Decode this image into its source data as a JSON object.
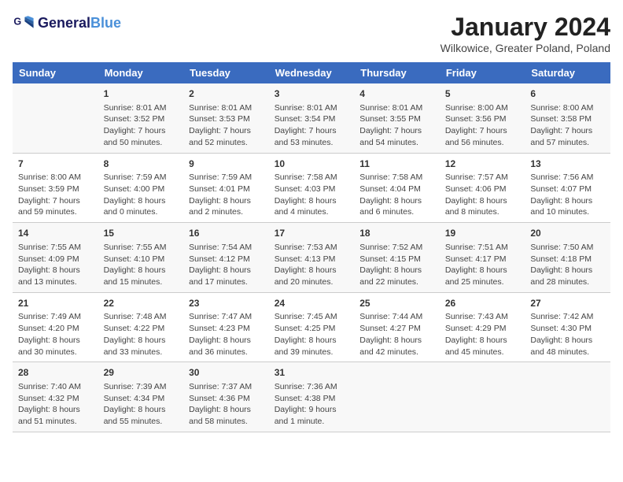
{
  "header": {
    "logo_line1": "General",
    "logo_line2": "Blue",
    "month_year": "January 2024",
    "location": "Wilkowice, Greater Poland, Poland"
  },
  "days_of_week": [
    "Sunday",
    "Monday",
    "Tuesday",
    "Wednesday",
    "Thursday",
    "Friday",
    "Saturday"
  ],
  "weeks": [
    [
      {
        "day": "",
        "info": ""
      },
      {
        "day": "1",
        "info": "Sunrise: 8:01 AM\nSunset: 3:52 PM\nDaylight: 7 hours\nand 50 minutes."
      },
      {
        "day": "2",
        "info": "Sunrise: 8:01 AM\nSunset: 3:53 PM\nDaylight: 7 hours\nand 52 minutes."
      },
      {
        "day": "3",
        "info": "Sunrise: 8:01 AM\nSunset: 3:54 PM\nDaylight: 7 hours\nand 53 minutes."
      },
      {
        "day": "4",
        "info": "Sunrise: 8:01 AM\nSunset: 3:55 PM\nDaylight: 7 hours\nand 54 minutes."
      },
      {
        "day": "5",
        "info": "Sunrise: 8:00 AM\nSunset: 3:56 PM\nDaylight: 7 hours\nand 56 minutes."
      },
      {
        "day": "6",
        "info": "Sunrise: 8:00 AM\nSunset: 3:58 PM\nDaylight: 7 hours\nand 57 minutes."
      }
    ],
    [
      {
        "day": "7",
        "info": "Sunrise: 8:00 AM\nSunset: 3:59 PM\nDaylight: 7 hours\nand 59 minutes."
      },
      {
        "day": "8",
        "info": "Sunrise: 7:59 AM\nSunset: 4:00 PM\nDaylight: 8 hours\nand 0 minutes."
      },
      {
        "day": "9",
        "info": "Sunrise: 7:59 AM\nSunset: 4:01 PM\nDaylight: 8 hours\nand 2 minutes."
      },
      {
        "day": "10",
        "info": "Sunrise: 7:58 AM\nSunset: 4:03 PM\nDaylight: 8 hours\nand 4 minutes."
      },
      {
        "day": "11",
        "info": "Sunrise: 7:58 AM\nSunset: 4:04 PM\nDaylight: 8 hours\nand 6 minutes."
      },
      {
        "day": "12",
        "info": "Sunrise: 7:57 AM\nSunset: 4:06 PM\nDaylight: 8 hours\nand 8 minutes."
      },
      {
        "day": "13",
        "info": "Sunrise: 7:56 AM\nSunset: 4:07 PM\nDaylight: 8 hours\nand 10 minutes."
      }
    ],
    [
      {
        "day": "14",
        "info": "Sunrise: 7:55 AM\nSunset: 4:09 PM\nDaylight: 8 hours\nand 13 minutes."
      },
      {
        "day": "15",
        "info": "Sunrise: 7:55 AM\nSunset: 4:10 PM\nDaylight: 8 hours\nand 15 minutes."
      },
      {
        "day": "16",
        "info": "Sunrise: 7:54 AM\nSunset: 4:12 PM\nDaylight: 8 hours\nand 17 minutes."
      },
      {
        "day": "17",
        "info": "Sunrise: 7:53 AM\nSunset: 4:13 PM\nDaylight: 8 hours\nand 20 minutes."
      },
      {
        "day": "18",
        "info": "Sunrise: 7:52 AM\nSunset: 4:15 PM\nDaylight: 8 hours\nand 22 minutes."
      },
      {
        "day": "19",
        "info": "Sunrise: 7:51 AM\nSunset: 4:17 PM\nDaylight: 8 hours\nand 25 minutes."
      },
      {
        "day": "20",
        "info": "Sunrise: 7:50 AM\nSunset: 4:18 PM\nDaylight: 8 hours\nand 28 minutes."
      }
    ],
    [
      {
        "day": "21",
        "info": "Sunrise: 7:49 AM\nSunset: 4:20 PM\nDaylight: 8 hours\nand 30 minutes."
      },
      {
        "day": "22",
        "info": "Sunrise: 7:48 AM\nSunset: 4:22 PM\nDaylight: 8 hours\nand 33 minutes."
      },
      {
        "day": "23",
        "info": "Sunrise: 7:47 AM\nSunset: 4:23 PM\nDaylight: 8 hours\nand 36 minutes."
      },
      {
        "day": "24",
        "info": "Sunrise: 7:45 AM\nSunset: 4:25 PM\nDaylight: 8 hours\nand 39 minutes."
      },
      {
        "day": "25",
        "info": "Sunrise: 7:44 AM\nSunset: 4:27 PM\nDaylight: 8 hours\nand 42 minutes."
      },
      {
        "day": "26",
        "info": "Sunrise: 7:43 AM\nSunset: 4:29 PM\nDaylight: 8 hours\nand 45 minutes."
      },
      {
        "day": "27",
        "info": "Sunrise: 7:42 AM\nSunset: 4:30 PM\nDaylight: 8 hours\nand 48 minutes."
      }
    ],
    [
      {
        "day": "28",
        "info": "Sunrise: 7:40 AM\nSunset: 4:32 PM\nDaylight: 8 hours\nand 51 minutes."
      },
      {
        "day": "29",
        "info": "Sunrise: 7:39 AM\nSunset: 4:34 PM\nDaylight: 8 hours\nand 55 minutes."
      },
      {
        "day": "30",
        "info": "Sunrise: 7:37 AM\nSunset: 4:36 PM\nDaylight: 8 hours\nand 58 minutes."
      },
      {
        "day": "31",
        "info": "Sunrise: 7:36 AM\nSunset: 4:38 PM\nDaylight: 9 hours\nand 1 minute."
      },
      {
        "day": "",
        "info": ""
      },
      {
        "day": "",
        "info": ""
      },
      {
        "day": "",
        "info": ""
      }
    ]
  ]
}
